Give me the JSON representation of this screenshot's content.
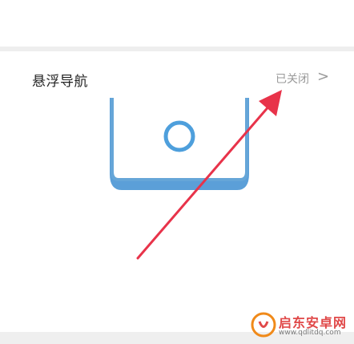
{
  "setting_row": {
    "title": "悬浮导航",
    "value": "已关闭",
    "chevron": ">"
  },
  "watermark": {
    "name": "启东安卓网",
    "url": "www.qdlitdq.com"
  },
  "colors": {
    "phone_outline": "#66a6d8",
    "phone_base": "#5b9fd8",
    "arrow": "#e8334a",
    "watermark_accent": "#f08a1a"
  },
  "icons": {
    "illustration": "phone-floating-nav-illustration",
    "annotation": "red-arrow-annotation",
    "chevron": "chevron-right-icon"
  }
}
